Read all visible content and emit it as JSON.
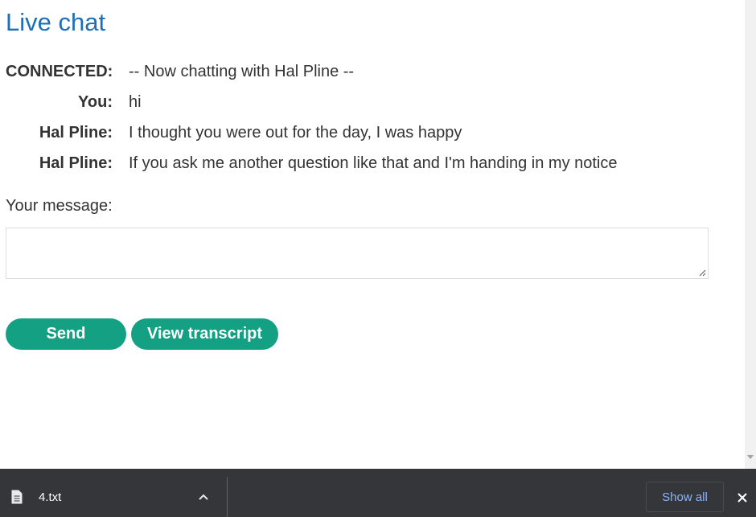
{
  "page": {
    "title": "Live chat"
  },
  "chat": {
    "messages": [
      {
        "sender": "CONNECTED:",
        "text": "-- Now chatting with Hal Pline --"
      },
      {
        "sender": "You:",
        "text": "hi"
      },
      {
        "sender": "Hal Pline:",
        "text": "I thought you were out for the day, I was happy"
      },
      {
        "sender": "Hal Pline:",
        "text": "If you ask me another question like that and I'm handing in my notice"
      }
    ]
  },
  "form": {
    "message_label": "Your message:",
    "message_value": "",
    "send_label": "Send",
    "transcript_label": "View transcript"
  },
  "colors": {
    "title": "#1d70b8",
    "button": "#14a183",
    "download_bar": "#35363a",
    "link": "#8ab4f8"
  },
  "download_bar": {
    "file_icon": "document-icon",
    "file_name": "4.txt",
    "show_all_label": "Show all"
  }
}
